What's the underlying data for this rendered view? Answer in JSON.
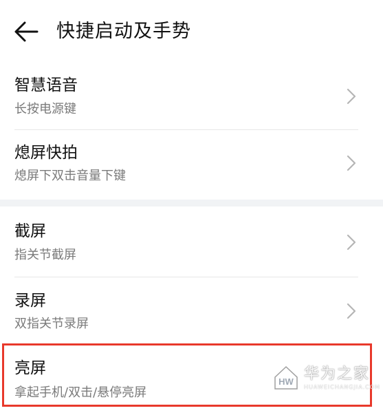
{
  "header": {
    "back_icon": "arrow-left-icon",
    "title": "快捷启动及手势"
  },
  "groups": [
    {
      "items": [
        {
          "title": "智慧语音",
          "subtitle": "长按电源键",
          "chevron_icon": "chevron-right-icon"
        },
        {
          "title": "熄屏快拍",
          "subtitle": "熄屏下双击音量下键",
          "chevron_icon": "chevron-right-icon"
        }
      ]
    },
    {
      "items": [
        {
          "title": "截屏",
          "subtitle": "指关节截屏",
          "chevron_icon": "chevron-right-icon"
        },
        {
          "title": "录屏",
          "subtitle": "双指关节录屏",
          "chevron_icon": "chevron-right-icon"
        },
        {
          "title": "亮屏",
          "subtitle": "拿起手机/双击/悬停亮屏",
          "chevron_icon": "chevron-right-icon"
        }
      ]
    }
  ],
  "annotation": {
    "highlight_color": "#e8392b"
  },
  "watermark": {
    "logo_text": "HW",
    "text": "华为之家",
    "subtext": "HUAWEICHANGJIA.COM"
  },
  "colors": {
    "background": "#ffffff",
    "section_gap": "#f1f3f5",
    "title_text": "#111111",
    "subtitle_text": "#7a7a7a",
    "divider": "#e6e6e6",
    "chevron": "#b5b5b5"
  }
}
